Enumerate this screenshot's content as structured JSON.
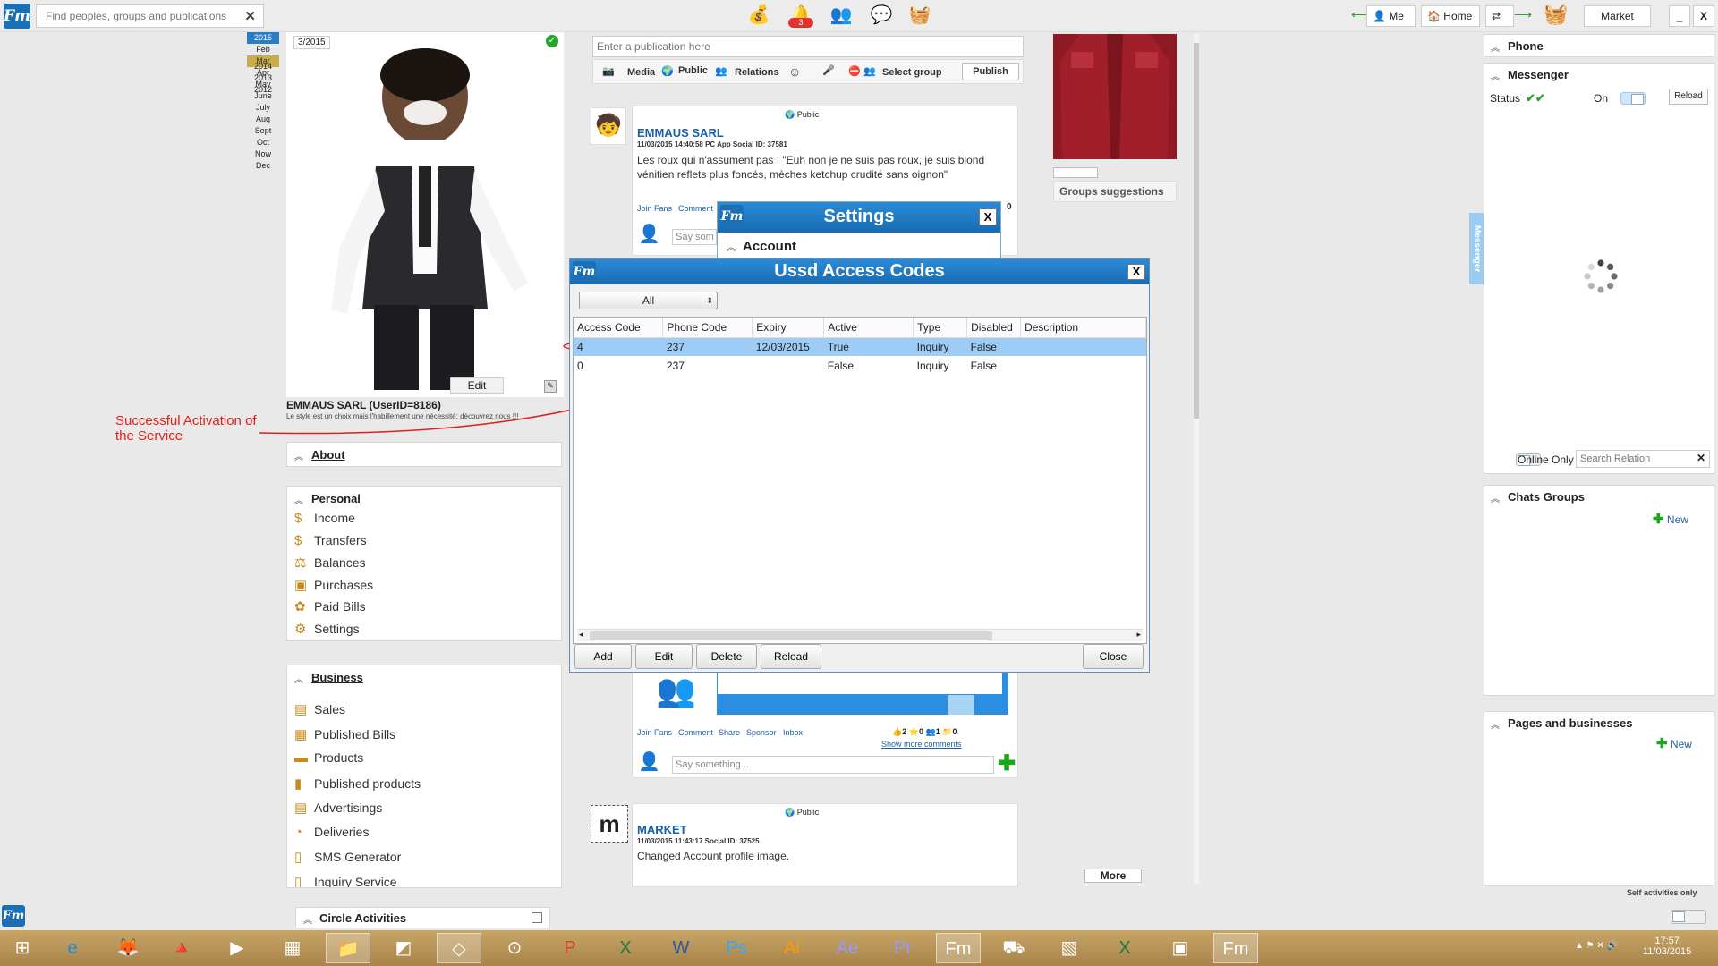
{
  "topbar": {
    "search_placeholder": "Find peoples, groups and publications",
    "notification_count": "3",
    "me_label": "Me",
    "home_label": "Home",
    "market_label": "Market",
    "minimize": "_",
    "close": "X"
  },
  "calendar": {
    "selected_year": "2015",
    "months": [
      "Feb",
      "Mar",
      "Apr",
      "May",
      "June",
      "July",
      "Aug",
      "Sept",
      "Oct",
      "Now",
      "Dec"
    ],
    "current_month": "Mar",
    "years": [
      "2014",
      "2013",
      "2012"
    ]
  },
  "profile": {
    "date_badge": "3/2015",
    "edit_label": "Edit",
    "name": "EMMAUS SARL (UserID=8186)",
    "tagline": "Le style est un choix mais l'habillement une nécessité; découvrez nous !!!"
  },
  "annotation": {
    "text_line1": "Successful Activation of",
    "text_line2": "the Service",
    "color": "#e0201a"
  },
  "about": {
    "title": "About"
  },
  "personal": {
    "title": "Personal",
    "items": [
      {
        "label": "Income",
        "icon": "$"
      },
      {
        "label": "Transfers",
        "icon": "$"
      },
      {
        "label": "Balances",
        "icon": "⚖"
      },
      {
        "label": "Purchases",
        "icon": "▣"
      },
      {
        "label": "Paid Bills",
        "icon": "✿"
      },
      {
        "label": "Settings",
        "icon": "⚙"
      }
    ]
  },
  "business": {
    "title": "Business",
    "items": [
      {
        "label": "Sales",
        "icon": "▤"
      },
      {
        "label": "Published Bills",
        "icon": "▦"
      },
      {
        "label": "Products",
        "icon": "▬"
      },
      {
        "label": "Published products",
        "icon": "▮"
      },
      {
        "label": "Advertisings",
        "icon": "▤"
      },
      {
        "label": "Deliveries",
        "icon": "◔"
      },
      {
        "label": "SMS Generator",
        "icon": "▯"
      },
      {
        "label": "Inquiry Service",
        "icon": "▯"
      }
    ]
  },
  "circle": {
    "title": "Circle Activities"
  },
  "publish": {
    "placeholder": "Enter a publication here",
    "media": "Media",
    "public": "Public",
    "relations": "Relations",
    "select_group": "Select group",
    "publish_btn": "Publish"
  },
  "post1": {
    "visibility": "Public",
    "author": "EMMAUS SARL",
    "meta": "11/03/2015 14:40:58  PC App  Social ID: 37581",
    "text": "Les roux qui n'assument pas : \"Euh non je ne suis pas roux, je suis blond vénitien reflets plus foncés, mèches ketchup crudité sans oignon\"",
    "join_fans": "Join Fans",
    "comment": "Comment",
    "say_placeholder": "Say som"
  },
  "post2": {
    "join_fans": "Join Fans",
    "comment": "Comment",
    "share": "Share",
    "sponsor": "Sponsor",
    "inbox": "Inbox",
    "count1": "2",
    "count2": "0",
    "count3": "1",
    "count4": "0",
    "show_more": "Show more comments",
    "say_placeholder": "Say something..."
  },
  "post3": {
    "visibility": "Public",
    "author": "MARKET",
    "meta": "11/03/2015 11:43:17   Social ID: 37525",
    "text": "Changed Account profile image."
  },
  "more_label": "More",
  "groups_suggestions": "Groups suggestions",
  "settings_dialog": {
    "title": "Settings",
    "close": "X",
    "section": "Account",
    "count": "0"
  },
  "ussd_dialog": {
    "title": "Ussd Access Codes",
    "close": "X",
    "filter_value": "All",
    "columns": [
      "Access Code",
      "Phone Code",
      "Expiry",
      "Active",
      "Type",
      "Disabled",
      "Description"
    ],
    "rows": [
      [
        "4",
        "237",
        "12/03/2015",
        "True",
        "Inquiry",
        "False",
        ""
      ],
      [
        "0",
        "237",
        "",
        "False",
        "Inquiry",
        "False",
        ""
      ]
    ],
    "add": "Add",
    "edit": "Edit",
    "delete": "Delete",
    "reload": "Reload",
    "close_btn": "Close"
  },
  "messenger_tab": "Messenger",
  "right": {
    "phone_title": "Phone",
    "messenger_title": "Messenger",
    "status_label": "Status",
    "on_label": "On",
    "reload_label": "Reload",
    "online_only": "Online Only",
    "search_relation": "Search Relation",
    "chats_groups": "Chats Groups",
    "new1": "New",
    "pages_businesses": "Pages and businesses",
    "new2": "New",
    "self_activities": "Self activities only"
  },
  "taskbar": {
    "time": "17:57",
    "date": "11/03/2015"
  },
  "colors": {
    "accent": "#1a6fb5",
    "selection": "#9dcdf6",
    "taskbar": "#b8935a"
  }
}
